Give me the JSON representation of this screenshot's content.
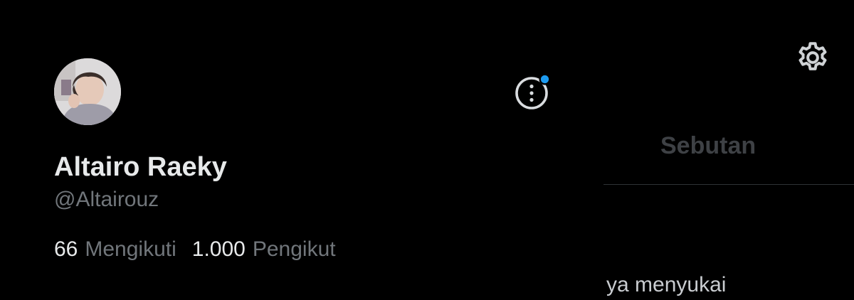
{
  "profile": {
    "display_name": "Altairo Raeky",
    "handle": "@Altairouz",
    "following_count": "66",
    "following_label": "Mengikuti",
    "followers_count": "1.000",
    "followers_label": "Pengikut"
  },
  "drawer_actions": {
    "more_icon": "more-vertical-circle-icon",
    "notification_dot_color": "#1d9bf0"
  },
  "background": {
    "settings_icon": "gear-icon",
    "mentions_tab_label": "Sebutan",
    "peek_text": "ya menyukai"
  },
  "colors": {
    "background": "#000000",
    "primary_text": "#e7e9ea",
    "secondary_text": "#71767b",
    "accent": "#1d9bf0"
  }
}
